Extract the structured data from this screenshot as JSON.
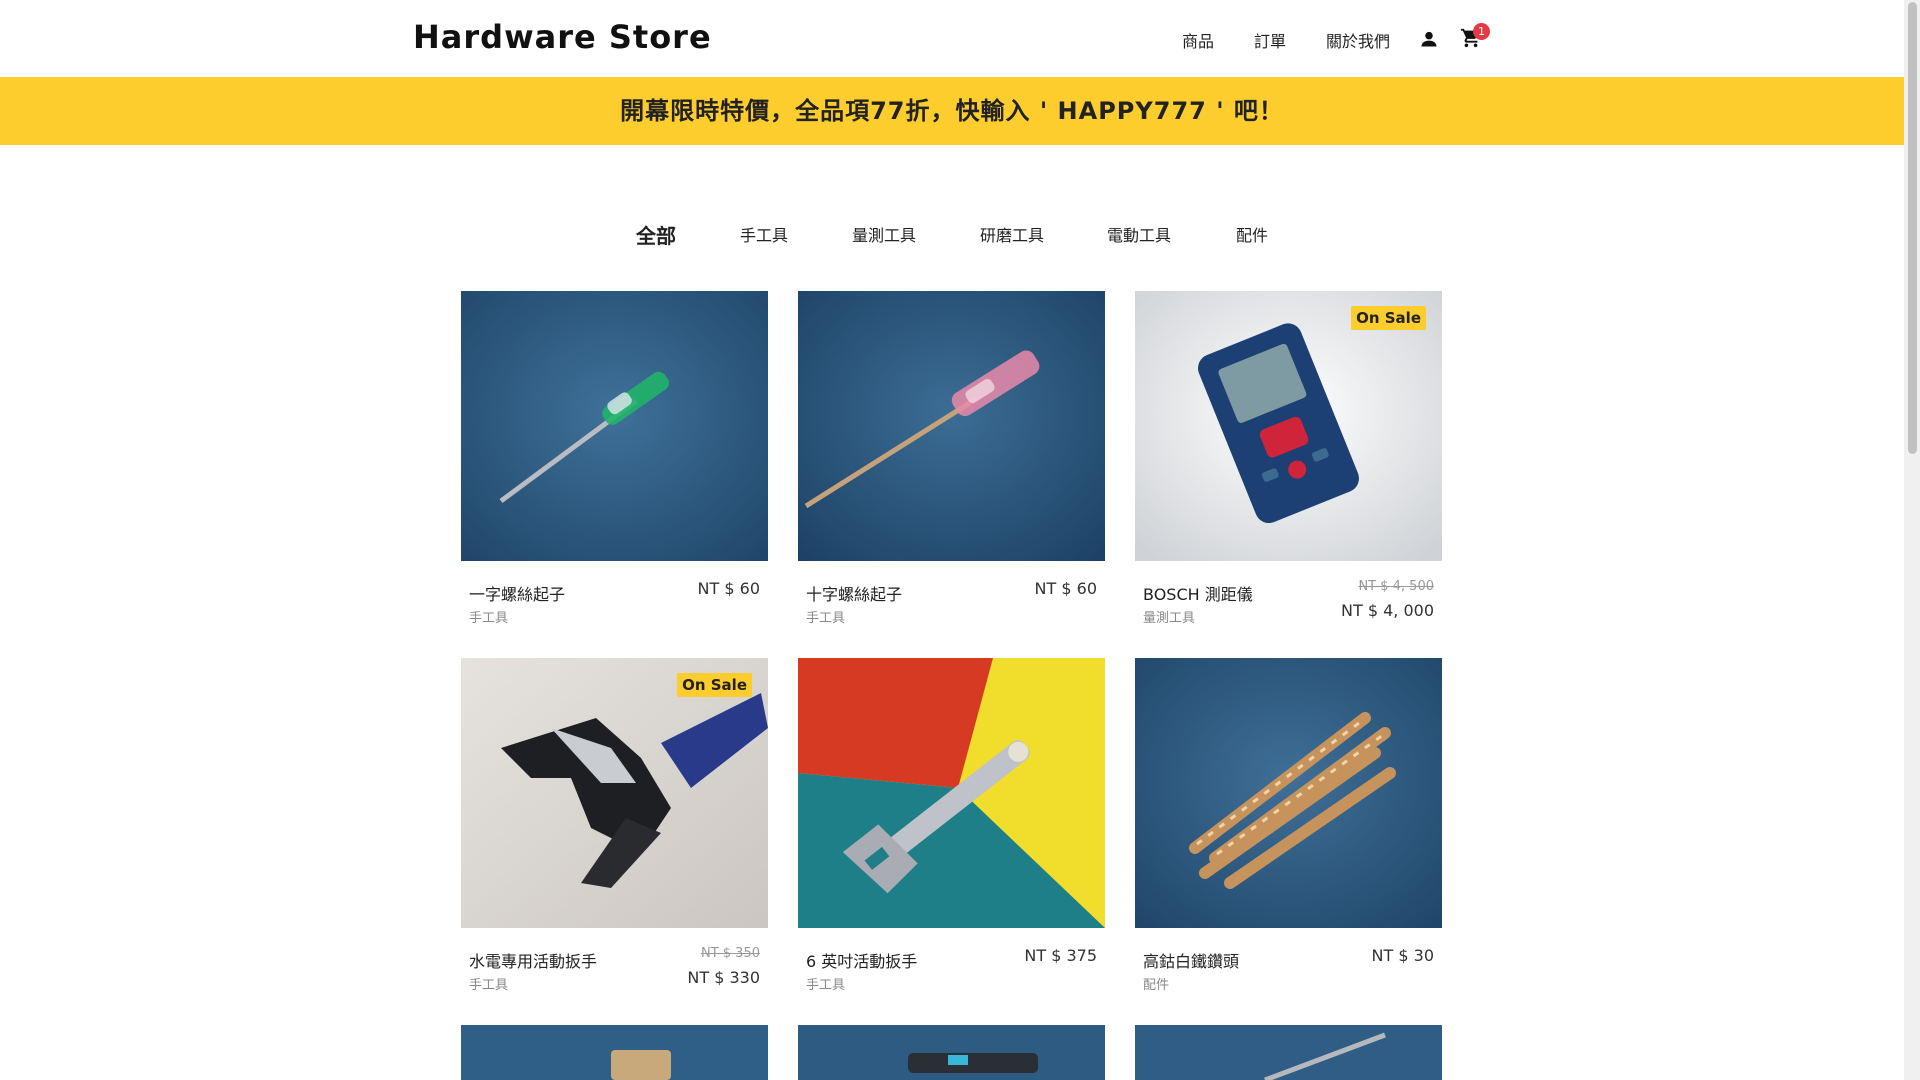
{
  "header": {
    "logo": "Hardware Store",
    "nav": [
      "商品",
      "訂單",
      "關於我們"
    ],
    "cart_count": "1",
    "icons": [
      "user-icon",
      "cart-icon"
    ]
  },
  "banner": {
    "text": "開幕限時特價，全品項77折，快輸入 ' HAPPY777 ' 吧！"
  },
  "categories": [
    "全部",
    "手工具",
    "量測工具",
    "研磨工具",
    "電動工具",
    "配件"
  ],
  "active_category": "全部",
  "products": [
    {
      "name": "一字螺絲起子",
      "category": "手工具",
      "price": "NT $ 60"
    },
    {
      "name": "十字螺絲起子",
      "category": "手工具",
      "price": "NT $ 60"
    },
    {
      "name": "BOSCH 測距儀",
      "category": "量測工具",
      "sale_badge": "On Sale",
      "old_price": "NT $ 4, 500",
      "price": "NT $ 4, 000"
    },
    {
      "name": "水電專用活動扳手",
      "category": "手工具",
      "sale_badge": "On Sale",
      "old_price": "NT $ 350",
      "price": "NT $ 330"
    },
    {
      "name": "6 英吋活動扳手",
      "category": "手工具",
      "price": "NT $ 375"
    },
    {
      "name": "高鈷白鐵鑽頭",
      "category": "配件",
      "price": "NT $ 30"
    }
  ],
  "colors": {
    "accent": "#fdcd2e",
    "badge": "#e53945",
    "photo_blue": "#2c5d84"
  }
}
